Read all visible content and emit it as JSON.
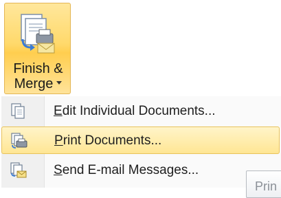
{
  "finish_merge": {
    "label_line1": "Finish &",
    "label_line2": "Merge",
    "icon": "finish-merge-icon"
  },
  "menu": {
    "items": [
      {
        "underline_char": "E",
        "label_rest": "dit Individual Documents...",
        "icon": "edit-documents-icon",
        "highlighted": false
      },
      {
        "underline_char": "P",
        "label_rest": "rint Documents...",
        "icon": "print-documents-icon",
        "highlighted": true
      },
      {
        "underline_char": "S",
        "label_rest": "end E-mail Messages...",
        "icon": "send-email-icon",
        "highlighted": false
      }
    ]
  },
  "behind_button": {
    "label": "Prin"
  },
  "colors": {
    "button_highlight": "#ffd96b",
    "menu_highlight": "#ffe694",
    "highlight_border": "#e8c25b",
    "gutter": "#f0f0f0"
  }
}
